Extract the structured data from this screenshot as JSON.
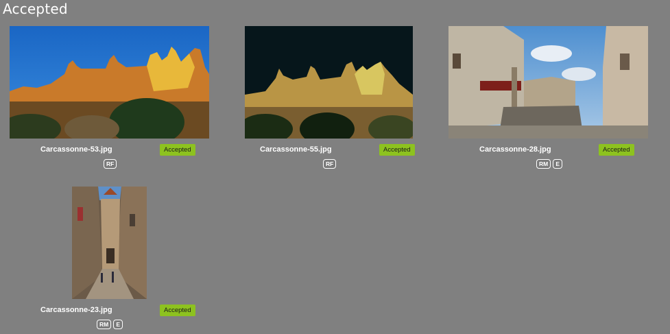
{
  "page": {
    "title": "Accepted"
  },
  "items": [
    {
      "filename": "Carcassonne-53.jpg",
      "status": "Accepted",
      "licenses": [
        "RF"
      ]
    },
    {
      "filename": "Carcassonne-55.jpg",
      "status": "Accepted",
      "licenses": [
        "RF"
      ]
    },
    {
      "filename": "Carcassonne-28.jpg",
      "status": "Accepted",
      "licenses": [
        "RM",
        "E"
      ]
    },
    {
      "filename": "Carcassonne-23.jpg",
      "status": "Accepted",
      "licenses": [
        "RM",
        "E"
      ]
    }
  ],
  "colors": {
    "background": "#808080",
    "status_accepted": "#8dc21f",
    "text": "#ffffff"
  }
}
